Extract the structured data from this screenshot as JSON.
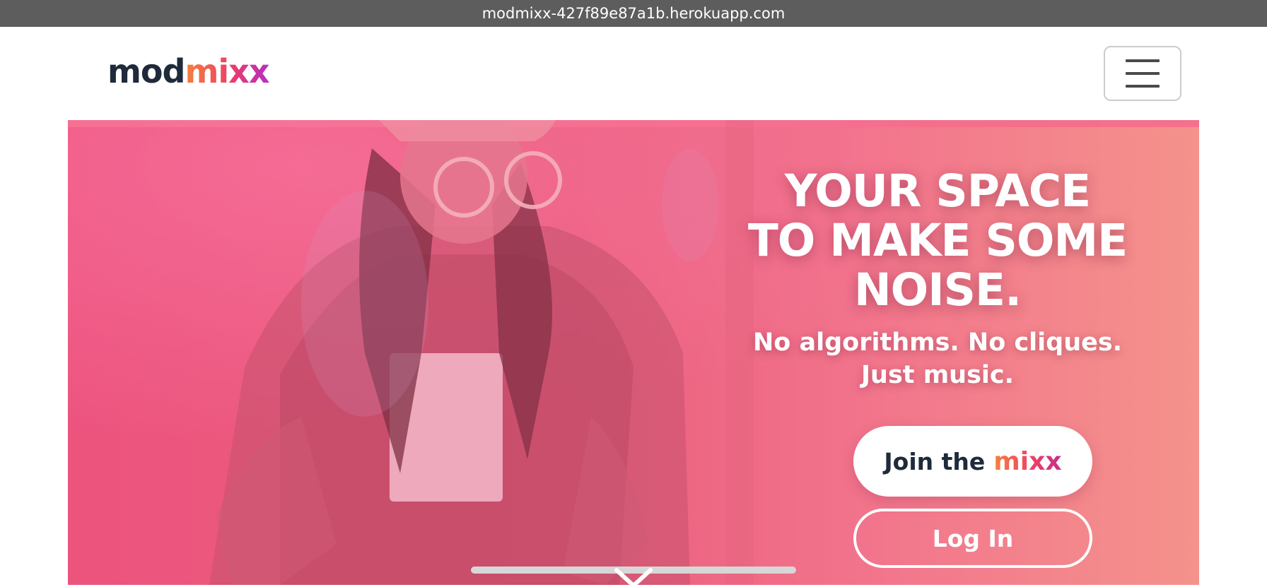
{
  "browser": {
    "url": "modmixx-427f89e87a1b.herokuapp.com"
  },
  "navbar": {
    "logo_prefix": "mod",
    "logo_suffix": "mixx",
    "menu_icon": "hamburger-menu-icon"
  },
  "hero": {
    "headline": "YOUR SPACE TO MAKE SOME NOISE.",
    "subhead_line1": "No algorithms. No cliques.",
    "subhead_line2": "Just music.",
    "join_prefix": "Join the",
    "join_brand": "mixx",
    "login_label": "Log In",
    "scroll_icon": "chevron-down-icon"
  },
  "colors": {
    "brand_dark": "#1f2a3b",
    "brand_orange": "#f5813e",
    "brand_pink": "#ec3d6a",
    "brand_purple": "#b42fc4",
    "hero_overlay": "#e86a88"
  }
}
